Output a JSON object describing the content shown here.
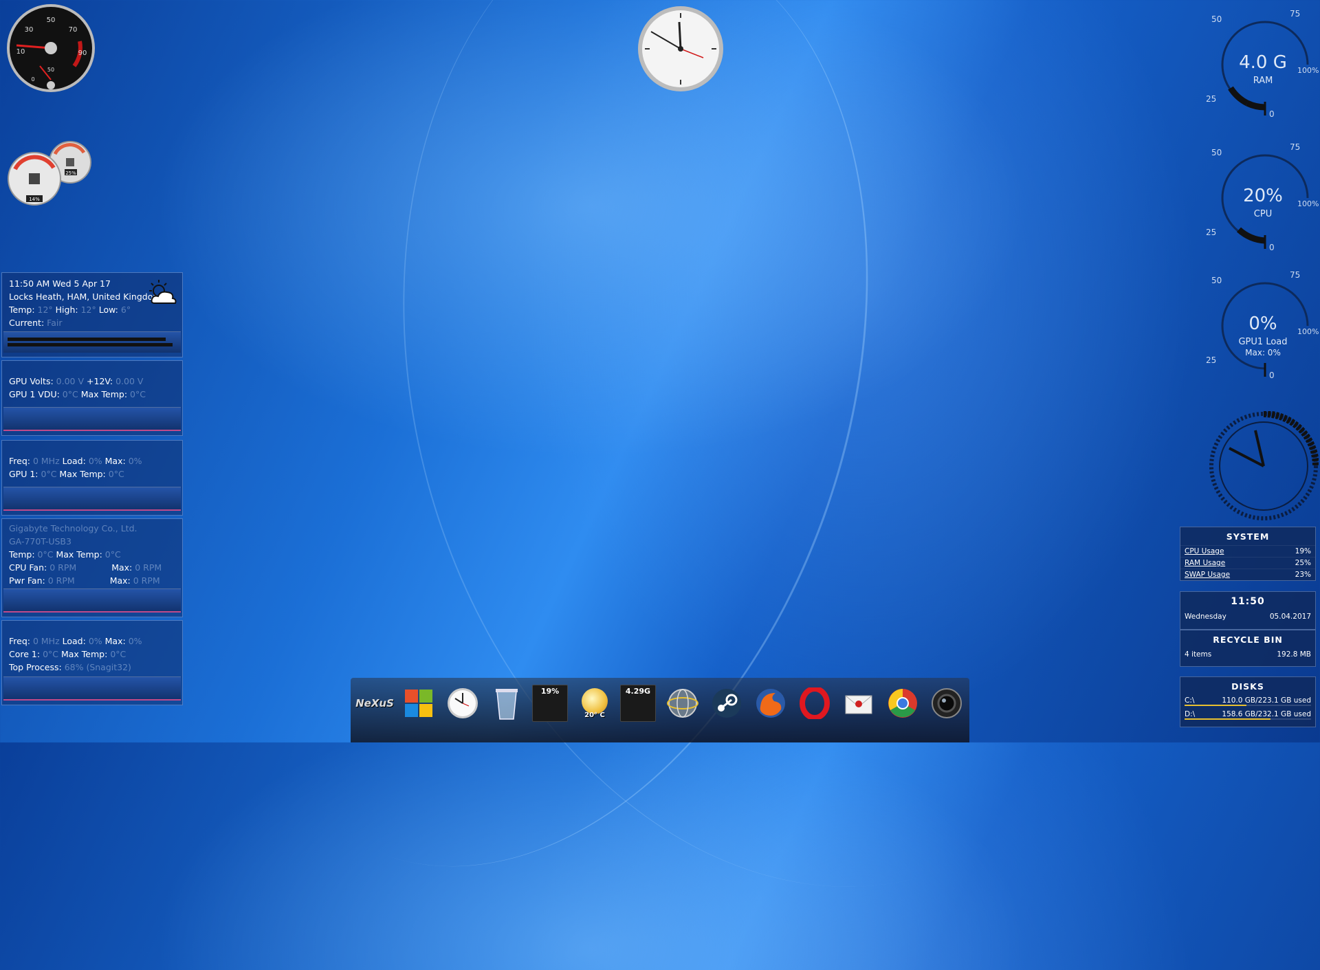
{
  "weather": {
    "datetime": "11:50 AM Wed 5 Apr 17",
    "location": "Locks Heath, HAM, United Kingdom",
    "temp_label": "Temp:",
    "temp": "12°",
    "high_label": "High:",
    "high": "12°",
    "low_label": "Low:",
    "low": "6°",
    "current_label": "Current:",
    "current": "Fair",
    "icon": "partly-cloudy-icon"
  },
  "gpu_volts": {
    "line1_label": "GPU Volts:",
    "line1_value": "0.00 V",
    "line1_label2": "+12V:",
    "line1_value2": "0.00 V",
    "line2_label": "GPU 1 VDU:",
    "line2_value": "0°C",
    "line2_label2": "Max Temp:",
    "line2_value2": "0°C"
  },
  "gpu_freq": {
    "freq_label": "Freq:",
    "freq": "0 MHz",
    "load_label": "Load:",
    "load": "0%",
    "max_label": "Max:",
    "max": "0%",
    "gpu_label": "GPU 1:",
    "gpu_temp": "0°C",
    "max_temp_label": "Max Temp:",
    "max_temp": "0°C"
  },
  "board": {
    "vendor": "Gigabyte Technology Co., Ltd.",
    "model": "GA-770T-USB3",
    "temp_label": "Temp:",
    "temp": "0°C",
    "max_temp_label": "Max Temp:",
    "max_temp": "0°C",
    "cpu_fan_label": "CPU Fan:",
    "cpu_fan": "0 RPM",
    "cpu_fan_max_label": "Max:",
    "cpu_fan_max": "0 RPM",
    "pwr_fan_label": "Pwr Fan:",
    "pwr_fan": "0 RPM",
    "pwr_fan_max_label": "Max:",
    "pwr_fan_max": "0 RPM"
  },
  "cpu_core": {
    "freq_label": "Freq:",
    "freq": "0 MHz",
    "load_label": "Load:",
    "load": "0%",
    "max_label": "Max:",
    "max": "0%",
    "core_label": "Core 1:",
    "core_temp": "0°C",
    "max_temp_label": "Max Temp:",
    "max_temp": "0°C",
    "top_label": "Top Process:",
    "top_value": "68% (Snagit32)"
  },
  "mini_gauges": {
    "left_value": "14%",
    "right_value": "25%"
  },
  "speedometer": {
    "ticks": [
      "50",
      "30",
      "70",
      "10",
      "90",
      "50",
      "0"
    ]
  },
  "gauge_ram": {
    "value": "4.0 G",
    "label": "RAM",
    "t50": "50",
    "t75": "75",
    "t25": "25",
    "t0": "0",
    "t100": "100%"
  },
  "gauge_cpu": {
    "value": "20%",
    "label": "CPU",
    "t50": "50",
    "t75": "75",
    "t25": "25",
    "t0": "0",
    "t100": "100%"
  },
  "gauge_gpu": {
    "value": "0%",
    "label": "GPU1 Load",
    "sub": "Max: 0%",
    "t50": "50",
    "t75": "75",
    "t25": "25",
    "t0": "0",
    "t100": "100%"
  },
  "system": {
    "title": "SYSTEM",
    "rows": [
      {
        "label": "CPU Usage",
        "value": "19%"
      },
      {
        "label": "RAM Usage",
        "value": "25%"
      },
      {
        "label": "SWAP Usage",
        "value": "23%"
      }
    ],
    "time": "11:50",
    "day": "Wednesday",
    "date": "05.04.2017"
  },
  "recycle": {
    "title": "RECYCLE BIN",
    "items": "4 items",
    "size": "192.8 MB"
  },
  "disks": {
    "title": "DISKS",
    "rows": [
      {
        "label": "C:\\",
        "value": "110.0 GB/223.1 GB used",
        "fraction": 0.49
      },
      {
        "label": "D:\\",
        "value": "158.6 GB/232.1 GB used",
        "fraction": 0.68
      }
    ]
  },
  "dock": {
    "logo": "NeXuS",
    "cpu_meter": "19%",
    "weather_temp": "20° C",
    "mem_meter": "4.29G",
    "icons": [
      "nexus-logo-icon",
      "windows-icon",
      "clock-icon",
      "recycle-bin-icon",
      "cpu-meter-icon",
      "weather-icon",
      "memory-meter-icon",
      "network-globe-icon",
      "steam-icon",
      "firefox-icon",
      "opera-icon",
      "mail-icon",
      "chrome-icon",
      "webcam-icon"
    ]
  }
}
